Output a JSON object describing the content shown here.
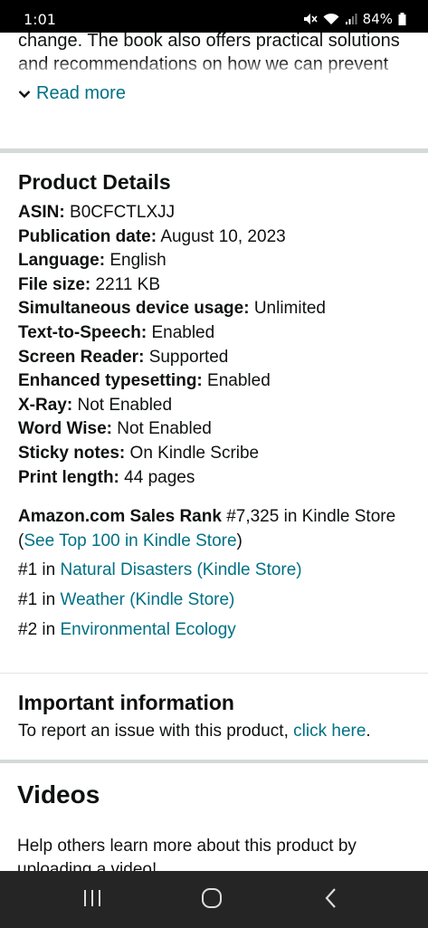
{
  "status_bar": {
    "time": "1:01",
    "battery": "84%"
  },
  "description": {
    "text": "change. The book also offers practical solutions and recommendations on how we can prevent and prepare for future wildfires, and how we",
    "read_more": "Read more"
  },
  "product_details": {
    "title": "Product Details",
    "rows": [
      {
        "label": "ASIN:",
        "value": "B0CFCTLXJJ"
      },
      {
        "label": "Publication date:",
        "value": "August 10, 2023"
      },
      {
        "label": "Language:",
        "value": "English"
      },
      {
        "label": "File size:",
        "value": "2211 KB"
      },
      {
        "label": "Simultaneous device usage:",
        "value": "Unlimited"
      },
      {
        "label": "Text-to-Speech:",
        "value": "Enabled"
      },
      {
        "label": "Screen Reader:",
        "value": "Supported"
      },
      {
        "label": "Enhanced typesetting:",
        "value": "Enabled"
      },
      {
        "label": "X-Ray:",
        "value": "Not Enabled"
      },
      {
        "label": "Word Wise:",
        "value": "Not Enabled"
      },
      {
        "label": "Sticky notes:",
        "value": "On Kindle Scribe"
      },
      {
        "label": "Print length:",
        "value": "44 pages"
      }
    ],
    "sales_rank": {
      "label": "Amazon.com Sales Rank",
      "value": "#7,325 in Kindle Store",
      "open_paren": "(",
      "link": "See Top 100 in Kindle Store",
      "close_paren": ")"
    },
    "category_ranks": [
      {
        "rank": "#1 in",
        "category": "Natural Disasters (Kindle Store)"
      },
      {
        "rank": "#1 in",
        "category": "Weather (Kindle Store)"
      },
      {
        "rank": "#2 in",
        "category": "Environmental Ecology"
      }
    ]
  },
  "important_information": {
    "title": "Important information",
    "text": "To report an issue with this product,",
    "link": "click here",
    "period": "."
  },
  "videos": {
    "title": "Videos",
    "text": "Help others learn more about this product by uploading a video!"
  },
  "colors": {
    "link": "#007185",
    "text": "#0f1111",
    "divider": "#d5d9d9"
  }
}
